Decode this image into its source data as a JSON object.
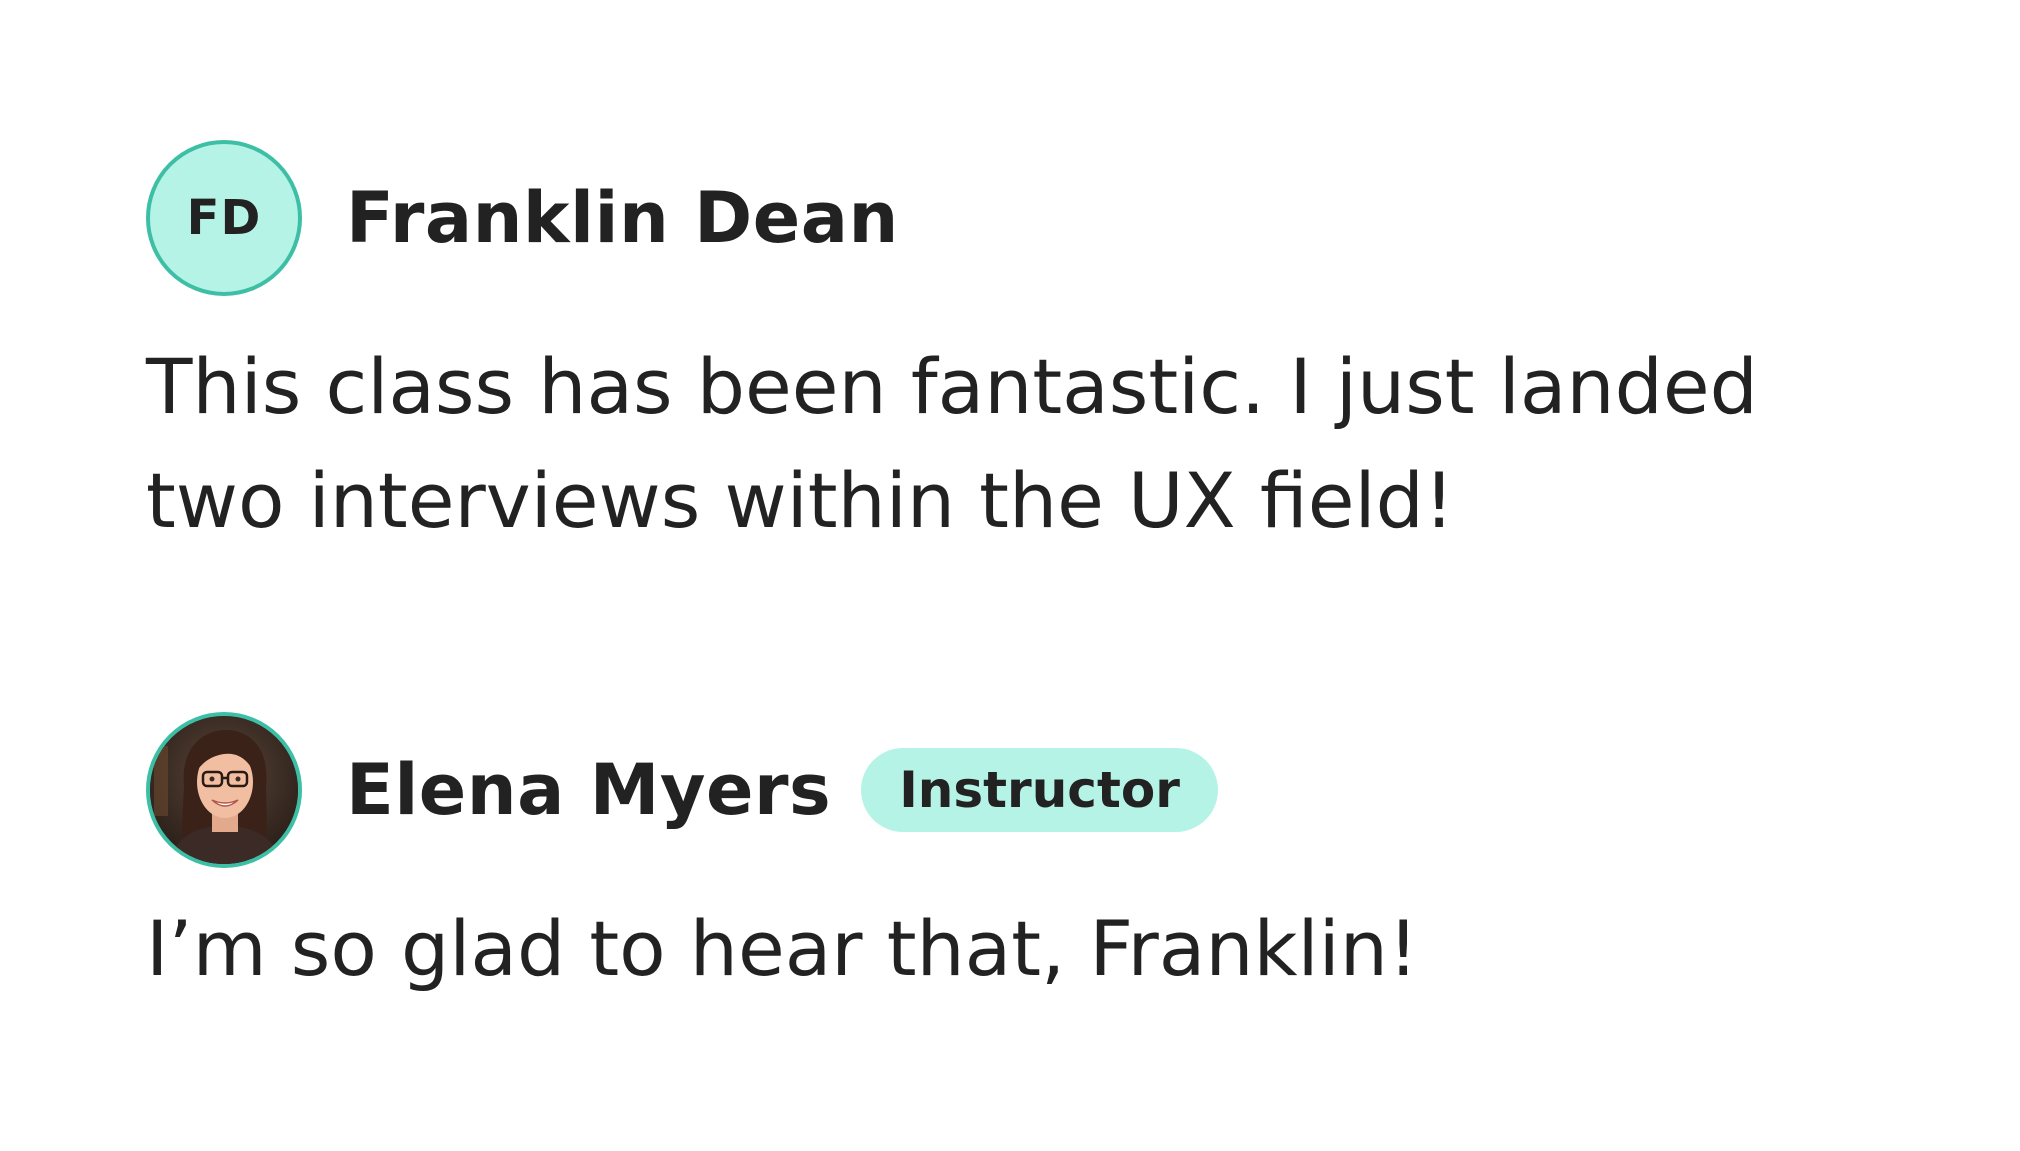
{
  "comments": [
    {
      "author": "Franklin Dean",
      "initials": "FD",
      "text": "This class has been fantastic. I just landed two interviews within the UX field!"
    },
    {
      "author": "Elena Myers",
      "badge": "Instructor",
      "avatar": "profile-photo",
      "text": "I’m so glad to hear that, Franklin!"
    }
  ],
  "colors": {
    "accent_border": "#3dbfa6",
    "accent_fill": "#b6f3e7",
    "text": "#222222",
    "background": "#ffffff"
  }
}
